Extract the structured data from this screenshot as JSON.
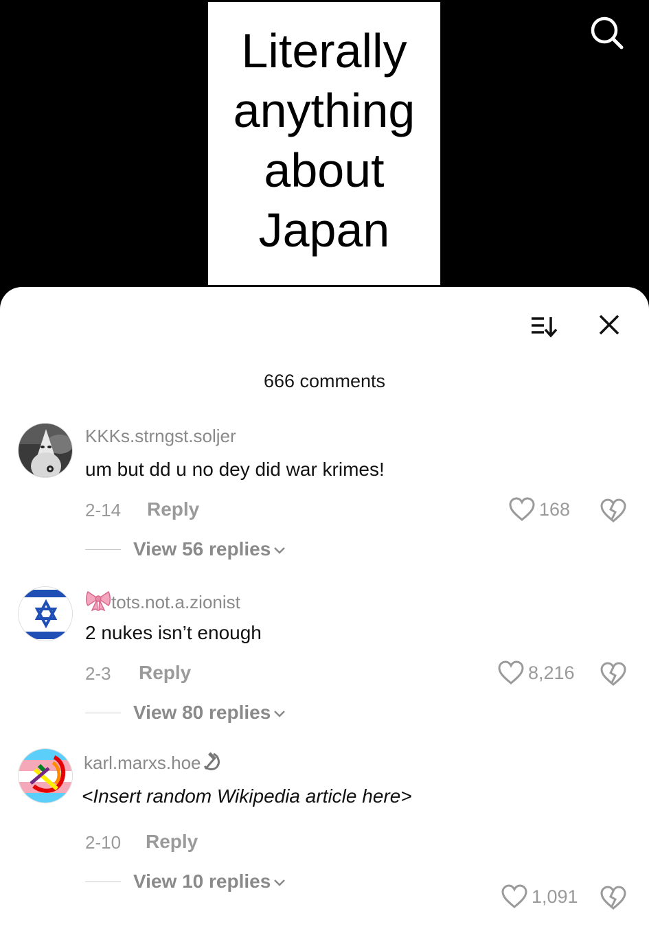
{
  "video": {
    "title_card": "Literally anything about Japan"
  },
  "panel": {
    "comment_count": "666 comments"
  },
  "comments": [
    {
      "username": "KKKs.strngst.soljer",
      "text": "um but dd u no dey did war krimes!",
      "date": "2-14",
      "reply_label": "Reply",
      "likes": "168",
      "view_replies": "View 56 replies"
    },
    {
      "username": "tots.not.a.zionist",
      "username_emoji": "ribbon-icon",
      "text": "2 nukes isn’t enough",
      "date": "2-3",
      "reply_label": "Reply",
      "likes": "8,216",
      "view_replies": "View 80 replies"
    },
    {
      "username": "karl.marxs.hoe",
      "username_emoji": "hammer-sickle-icon",
      "text": "<Insert random Wikipedia article here>",
      "date": "2-10",
      "reply_label": "Reply",
      "likes": "1,091",
      "view_replies": "View 10 replies"
    }
  ],
  "colors": {
    "muted_text": "#9a9a9a",
    "background_top": "#000000",
    "sheet": "#ffffff",
    "flag_blue": "#1f4fb4"
  }
}
